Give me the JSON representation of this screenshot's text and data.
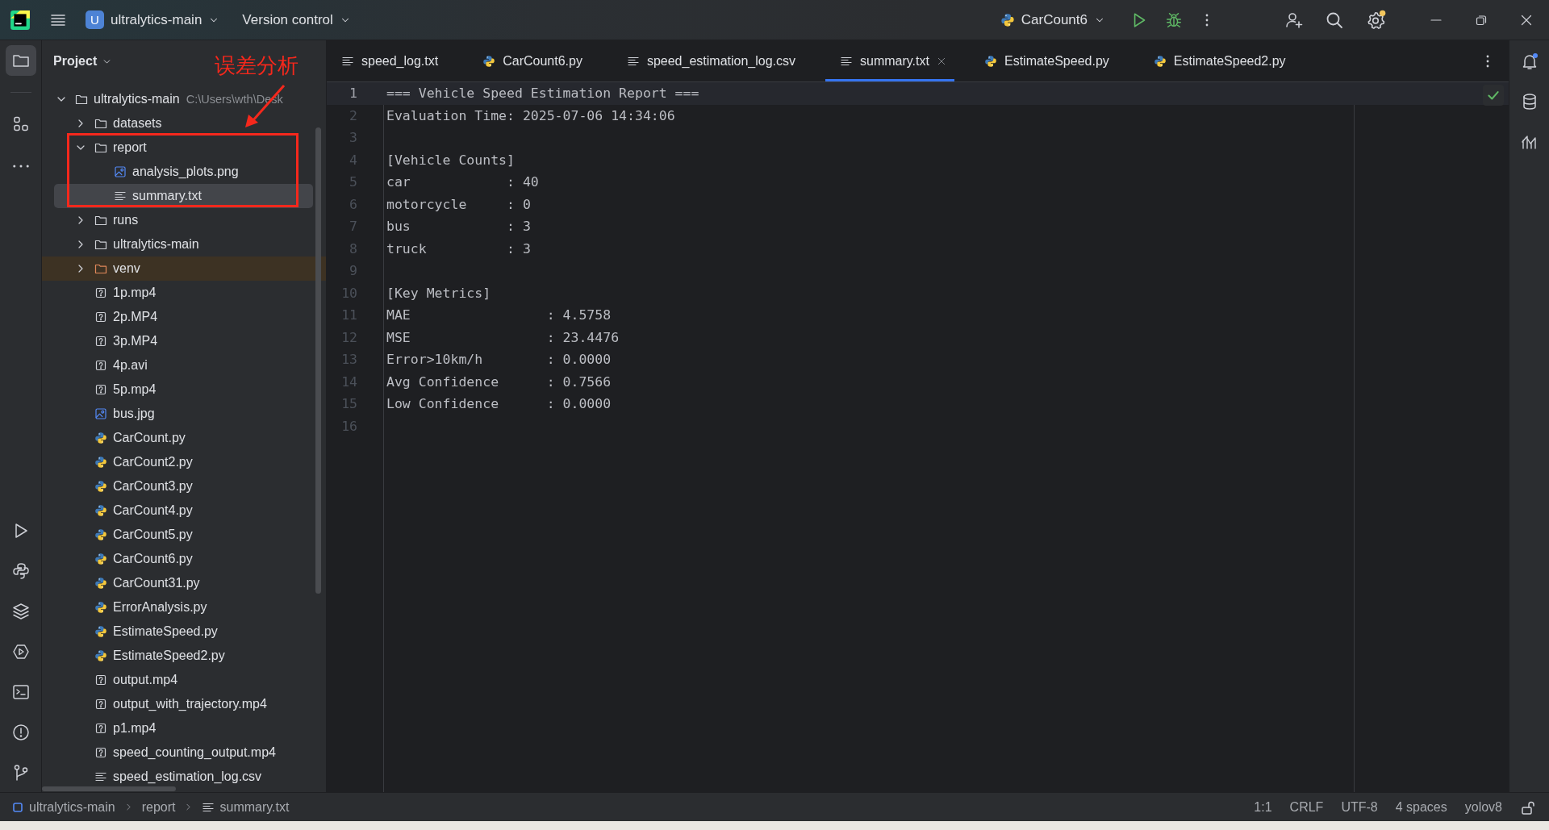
{
  "title_bar": {
    "project_badge": "U",
    "project": "ultralytics-main",
    "vcs": "Version control",
    "run_config": "CarCount6"
  },
  "tool_strip": {
    "top": [
      {
        "kind": "project",
        "selected": true
      },
      {
        "kind": "structure",
        "selected": false
      },
      {
        "kind": "more",
        "selected": false
      }
    ],
    "bottom": [
      {
        "kind": "run",
        "selected": false
      },
      {
        "kind": "python",
        "selected": false
      },
      {
        "kind": "layers",
        "selected": false
      },
      {
        "kind": "services",
        "selected": false
      },
      {
        "kind": "terminal",
        "selected": false
      },
      {
        "kind": "problems",
        "selected": false
      },
      {
        "kind": "git",
        "selected": false
      }
    ]
  },
  "project_panel": {
    "title": "Project",
    "tree": [
      {
        "label": "ultralytics-main",
        "path_hint": "C:\\Users\\wth\\Desk",
        "kind": "folder",
        "expanded": true,
        "selected": false,
        "children": [
          {
            "label": "datasets",
            "kind": "folder",
            "expanded": false,
            "selected": false
          },
          {
            "label": "report",
            "kind": "folder",
            "expanded": true,
            "selected": false,
            "children": [
              {
                "label": "analysis_plots.png",
                "kind": "image",
                "selected": false
              },
              {
                "label": "summary.txt",
                "kind": "text",
                "selected": true
              }
            ]
          },
          {
            "label": "runs",
            "kind": "folder",
            "expanded": false,
            "selected": false
          },
          {
            "label": "ultralytics-main",
            "kind": "folder",
            "expanded": false,
            "selected": false
          },
          {
            "label": "venv",
            "kind": "excluded_folder",
            "expanded": false,
            "selected": false
          },
          {
            "label": "1p.mp4",
            "kind": "unknown",
            "selected": false
          },
          {
            "label": "2p.MP4",
            "kind": "unknown",
            "selected": false
          },
          {
            "label": "3p.MP4",
            "kind": "unknown",
            "selected": false
          },
          {
            "label": "4p.avi",
            "kind": "unknown",
            "selected": false
          },
          {
            "label": "5p.mp4",
            "kind": "unknown",
            "selected": false
          },
          {
            "label": "bus.jpg",
            "kind": "image",
            "selected": false
          },
          {
            "label": "CarCount.py",
            "kind": "python",
            "selected": false
          },
          {
            "label": "CarCount2.py",
            "kind": "python",
            "selected": false
          },
          {
            "label": "CarCount3.py",
            "kind": "python",
            "selected": false
          },
          {
            "label": "CarCount4.py",
            "kind": "python",
            "selected": false
          },
          {
            "label": "CarCount5.py",
            "kind": "python",
            "selected": false
          },
          {
            "label": "CarCount6.py",
            "kind": "python",
            "selected": false
          },
          {
            "label": "CarCount31.py",
            "kind": "python",
            "selected": false
          },
          {
            "label": "ErrorAnalysis.py",
            "kind": "python",
            "selected": false
          },
          {
            "label": "EstimateSpeed.py",
            "kind": "python",
            "selected": false
          },
          {
            "label": "EstimateSpeed2.py",
            "kind": "python",
            "selected": false
          },
          {
            "label": "output.mp4",
            "kind": "unknown",
            "selected": false
          },
          {
            "label": "output_with_trajectory.mp4",
            "kind": "unknown",
            "selected": false
          },
          {
            "label": "p1.mp4",
            "kind": "unknown",
            "selected": false
          },
          {
            "label": "speed_counting_output.mp4",
            "kind": "unknown",
            "selected": false
          },
          {
            "label": "speed_estimation_log.csv",
            "kind": "text",
            "selected": false
          }
        ]
      }
    ]
  },
  "annotation": {
    "text": "误差分析"
  },
  "tabs": [
    {
      "label": "speed_log.txt",
      "kind": "text",
      "selected": false
    },
    {
      "label": "CarCount6.py",
      "kind": "python",
      "selected": false
    },
    {
      "label": "speed_estimation_log.csv",
      "kind": "text",
      "selected": false
    },
    {
      "label": "summary.txt",
      "kind": "text",
      "selected": true
    },
    {
      "label": "EstimateSpeed.py",
      "kind": "python",
      "selected": false
    },
    {
      "label": "EstimateSpeed2.py",
      "kind": "python",
      "selected": false
    }
  ],
  "editor": {
    "lines": [
      {
        "number": "1",
        "text": "=== Vehicle Speed Estimation Report ===",
        "current": true
      },
      {
        "number": "2",
        "text": "Evaluation Time: 2025-07-06 14:34:06",
        "current": false
      },
      {
        "number": "3",
        "current": false
      },
      {
        "number": "4",
        "text": "[Vehicle Counts]",
        "current": false
      },
      {
        "number": "5",
        "text": "car            : 40",
        "current": false
      },
      {
        "number": "6",
        "text": "motorcycle     : 0",
        "current": false
      },
      {
        "number": "7",
        "text": "bus            : 3",
        "current": false
      },
      {
        "number": "8",
        "text": "truck          : 3",
        "current": false
      },
      {
        "number": "9",
        "current": false
      },
      {
        "number": "10",
        "text": "[Key Metrics]",
        "current": false
      },
      {
        "number": "11",
        "text": "MAE                 : 4.5758",
        "current": false
      },
      {
        "number": "12",
        "text": "MSE                 : 23.4476",
        "current": false
      },
      {
        "number": "13",
        "text": "Error>10km/h        : 0.0000",
        "current": false
      },
      {
        "number": "14",
        "text": "Avg Confidence      : 0.7566",
        "current": false
      },
      {
        "number": "15",
        "text": "Low Confidence      : 0.0000",
        "current": false
      },
      {
        "number": "16",
        "current": false
      }
    ]
  },
  "status_bar": {
    "breadcrumbs": [
      {
        "label": "ultralytics-main",
        "kind": "module"
      },
      {
        "label": "report",
        "kind": "folder"
      },
      {
        "label": "summary.txt",
        "kind": "text"
      }
    ],
    "items": [
      "1:1",
      "CRLF",
      "UTF-8",
      "4 spaces",
      "yolov8"
    ]
  }
}
